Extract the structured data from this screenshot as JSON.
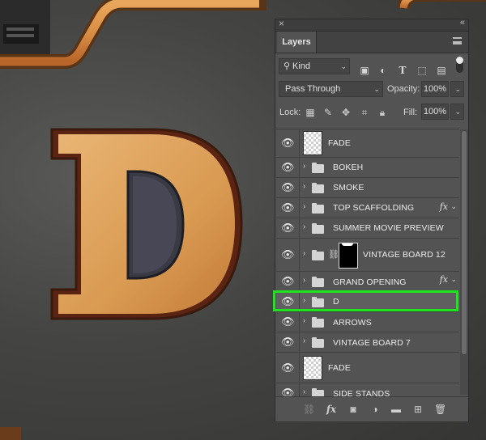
{
  "canvas": {
    "letter": "D"
  },
  "panel": {
    "tab": "Layers",
    "filter": {
      "kind_label": "Kind",
      "kind_icon": "search-icon",
      "icons": [
        "image-filter-icon",
        "adjustment-filter-icon",
        "type-filter-icon",
        "shape-filter-icon",
        "smart-object-filter-icon"
      ]
    },
    "blend_mode": "Pass Through",
    "opacity_label": "Opacity:",
    "opacity_value": "100%",
    "lock_label": "Lock:",
    "fill_label": "Fill:",
    "fill_value": "100%",
    "layers": [
      {
        "name": "FADE",
        "type": "pixel",
        "visible": true
      },
      {
        "name": "BOKEH",
        "type": "group",
        "visible": true
      },
      {
        "name": "SMOKE",
        "type": "group",
        "visible": true
      },
      {
        "name": "TOP SCAFFOLDING",
        "type": "group",
        "visible": true,
        "fx": "fx"
      },
      {
        "name": "SUMMER MOVIE PREVIEW",
        "type": "group",
        "visible": true
      },
      {
        "name": "VINTAGE BOARD 12",
        "type": "group-masked",
        "visible": true
      },
      {
        "name": "GRAND OPENING",
        "type": "group",
        "visible": true,
        "fx": "fx"
      },
      {
        "name": "D",
        "type": "group",
        "visible": true,
        "selected": true
      },
      {
        "name": "ARROWS",
        "type": "group",
        "visible": true
      },
      {
        "name": "VINTAGE BOARD 7",
        "type": "group",
        "visible": true
      },
      {
        "name": "FADE",
        "type": "pixel",
        "visible": true
      },
      {
        "name": "SIDE STANDS",
        "type": "group",
        "visible": true
      }
    ],
    "bottom_icons": [
      "link-layers-icon",
      "fx-icon",
      "add-mask-icon",
      "adjustment-layer-icon",
      "new-group-icon",
      "new-layer-icon",
      "trash-icon"
    ],
    "highlight_color": "#1ee61e"
  }
}
